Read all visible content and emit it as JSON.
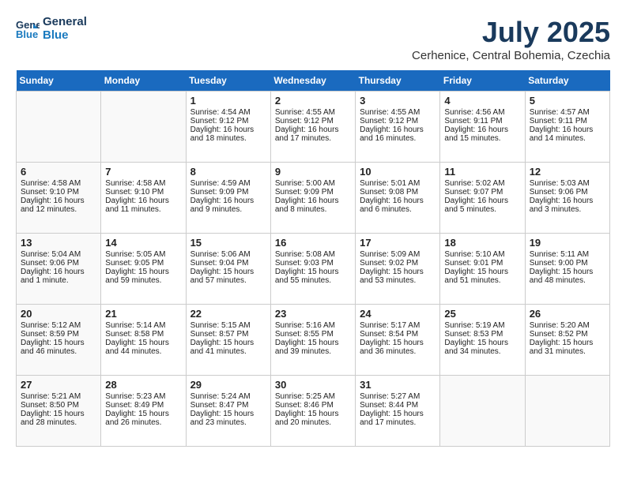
{
  "header": {
    "logo_line1": "General",
    "logo_line2": "Blue",
    "month": "July 2025",
    "location": "Cerhenice, Central Bohemia, Czechia"
  },
  "weekdays": [
    "Sunday",
    "Monday",
    "Tuesday",
    "Wednesday",
    "Thursday",
    "Friday",
    "Saturday"
  ],
  "weeks": [
    [
      {
        "day": "",
        "info": ""
      },
      {
        "day": "",
        "info": ""
      },
      {
        "day": "1",
        "info": "Sunrise: 4:54 AM\nSunset: 9:12 PM\nDaylight: 16 hours and 18 minutes."
      },
      {
        "day": "2",
        "info": "Sunrise: 4:55 AM\nSunset: 9:12 PM\nDaylight: 16 hours and 17 minutes."
      },
      {
        "day": "3",
        "info": "Sunrise: 4:55 AM\nSunset: 9:12 PM\nDaylight: 16 hours and 16 minutes."
      },
      {
        "day": "4",
        "info": "Sunrise: 4:56 AM\nSunset: 9:11 PM\nDaylight: 16 hours and 15 minutes."
      },
      {
        "day": "5",
        "info": "Sunrise: 4:57 AM\nSunset: 9:11 PM\nDaylight: 16 hours and 14 minutes."
      }
    ],
    [
      {
        "day": "6",
        "info": "Sunrise: 4:58 AM\nSunset: 9:10 PM\nDaylight: 16 hours and 12 minutes."
      },
      {
        "day": "7",
        "info": "Sunrise: 4:58 AM\nSunset: 9:10 PM\nDaylight: 16 hours and 11 minutes."
      },
      {
        "day": "8",
        "info": "Sunrise: 4:59 AM\nSunset: 9:09 PM\nDaylight: 16 hours and 9 minutes."
      },
      {
        "day": "9",
        "info": "Sunrise: 5:00 AM\nSunset: 9:09 PM\nDaylight: 16 hours and 8 minutes."
      },
      {
        "day": "10",
        "info": "Sunrise: 5:01 AM\nSunset: 9:08 PM\nDaylight: 16 hours and 6 minutes."
      },
      {
        "day": "11",
        "info": "Sunrise: 5:02 AM\nSunset: 9:07 PM\nDaylight: 16 hours and 5 minutes."
      },
      {
        "day": "12",
        "info": "Sunrise: 5:03 AM\nSunset: 9:06 PM\nDaylight: 16 hours and 3 minutes."
      }
    ],
    [
      {
        "day": "13",
        "info": "Sunrise: 5:04 AM\nSunset: 9:06 PM\nDaylight: 16 hours and 1 minute."
      },
      {
        "day": "14",
        "info": "Sunrise: 5:05 AM\nSunset: 9:05 PM\nDaylight: 15 hours and 59 minutes."
      },
      {
        "day": "15",
        "info": "Sunrise: 5:06 AM\nSunset: 9:04 PM\nDaylight: 15 hours and 57 minutes."
      },
      {
        "day": "16",
        "info": "Sunrise: 5:08 AM\nSunset: 9:03 PM\nDaylight: 15 hours and 55 minutes."
      },
      {
        "day": "17",
        "info": "Sunrise: 5:09 AM\nSunset: 9:02 PM\nDaylight: 15 hours and 53 minutes."
      },
      {
        "day": "18",
        "info": "Sunrise: 5:10 AM\nSunset: 9:01 PM\nDaylight: 15 hours and 51 minutes."
      },
      {
        "day": "19",
        "info": "Sunrise: 5:11 AM\nSunset: 9:00 PM\nDaylight: 15 hours and 48 minutes."
      }
    ],
    [
      {
        "day": "20",
        "info": "Sunrise: 5:12 AM\nSunset: 8:59 PM\nDaylight: 15 hours and 46 minutes."
      },
      {
        "day": "21",
        "info": "Sunrise: 5:14 AM\nSunset: 8:58 PM\nDaylight: 15 hours and 44 minutes."
      },
      {
        "day": "22",
        "info": "Sunrise: 5:15 AM\nSunset: 8:57 PM\nDaylight: 15 hours and 41 minutes."
      },
      {
        "day": "23",
        "info": "Sunrise: 5:16 AM\nSunset: 8:55 PM\nDaylight: 15 hours and 39 minutes."
      },
      {
        "day": "24",
        "info": "Sunrise: 5:17 AM\nSunset: 8:54 PM\nDaylight: 15 hours and 36 minutes."
      },
      {
        "day": "25",
        "info": "Sunrise: 5:19 AM\nSunset: 8:53 PM\nDaylight: 15 hours and 34 minutes."
      },
      {
        "day": "26",
        "info": "Sunrise: 5:20 AM\nSunset: 8:52 PM\nDaylight: 15 hours and 31 minutes."
      }
    ],
    [
      {
        "day": "27",
        "info": "Sunrise: 5:21 AM\nSunset: 8:50 PM\nDaylight: 15 hours and 28 minutes."
      },
      {
        "day": "28",
        "info": "Sunrise: 5:23 AM\nSunset: 8:49 PM\nDaylight: 15 hours and 26 minutes."
      },
      {
        "day": "29",
        "info": "Sunrise: 5:24 AM\nSunset: 8:47 PM\nDaylight: 15 hours and 23 minutes."
      },
      {
        "day": "30",
        "info": "Sunrise: 5:25 AM\nSunset: 8:46 PM\nDaylight: 15 hours and 20 minutes."
      },
      {
        "day": "31",
        "info": "Sunrise: 5:27 AM\nSunset: 8:44 PM\nDaylight: 15 hours and 17 minutes."
      },
      {
        "day": "",
        "info": ""
      },
      {
        "day": "",
        "info": ""
      }
    ]
  ]
}
